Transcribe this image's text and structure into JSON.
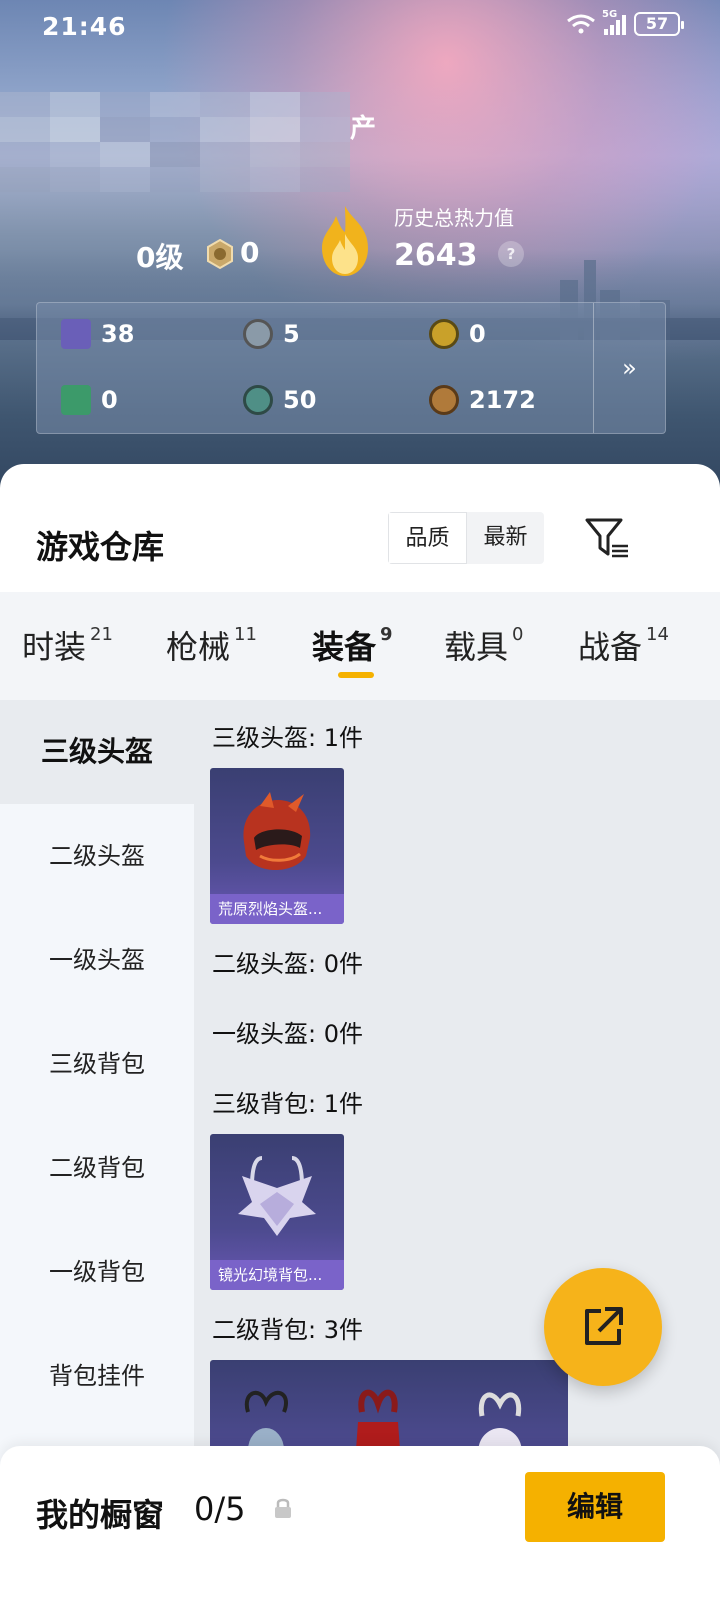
{
  "status_bar": {
    "time": "21:46",
    "network": "5G",
    "battery": "57"
  },
  "profile": {
    "name_suffix": "产",
    "level": "0级",
    "rank_value": "0",
    "heat_label": "历史总热力值",
    "heat_value": "2643",
    "help": "?"
  },
  "resources": [
    {
      "icon": "purple-card-icon",
      "value": "38",
      "color": "#6a5fb8"
    },
    {
      "icon": "silver-coin-icon",
      "value": "5",
      "color": "#8a9aa8"
    },
    {
      "icon": "gold-badge-icon",
      "value": "0",
      "color": "#c9a12a"
    },
    {
      "icon": "green-card-icon",
      "value": "0",
      "color": "#3c9a6a"
    },
    {
      "icon": "teal-coin-icon",
      "value": "50",
      "color": "#4f8f86"
    },
    {
      "icon": "bronze-coin-icon",
      "value": "2172",
      "color": "#b07a3a"
    }
  ],
  "resources_more": "»",
  "warehouse": {
    "title": "游戏仓库",
    "sort_options": [
      "品质",
      "最新"
    ],
    "active_sort": "品质"
  },
  "tabs": [
    {
      "label": "时装",
      "count": "21"
    },
    {
      "label": "枪械",
      "count": "11"
    },
    {
      "label": "装备",
      "count": "9"
    },
    {
      "label": "载具",
      "count": "0"
    },
    {
      "label": "战备",
      "count": "14"
    }
  ],
  "active_tab": "装备",
  "sidebar": [
    "三级头盔",
    "二级头盔",
    "一级头盔",
    "三级背包",
    "二级背包",
    "一级背包",
    "背包挂件"
  ],
  "active_sidebar": "三级头盔",
  "sections": [
    {
      "label": "三级头盔: 1件",
      "items": [
        {
          "name": "荒原烈焰头盔..."
        }
      ]
    },
    {
      "label": "二级头盔: 0件",
      "items": []
    },
    {
      "label": "一级头盔: 0件",
      "items": []
    },
    {
      "label": "三级背包: 1件",
      "items": [
        {
          "name": "镜光幻境背包..."
        }
      ]
    },
    {
      "label": "二级背包: 3件",
      "items": [
        {
          "name": ""
        },
        {
          "name": ""
        },
        {
          "name": ""
        }
      ]
    }
  ],
  "showcase": {
    "title": "我的橱窗",
    "count": "0/5",
    "edit_label": "编辑"
  },
  "colors": {
    "accent": "#f5b100",
    "item_bg": "#4c4a8e",
    "item_label_bg": "#7a63c9"
  }
}
